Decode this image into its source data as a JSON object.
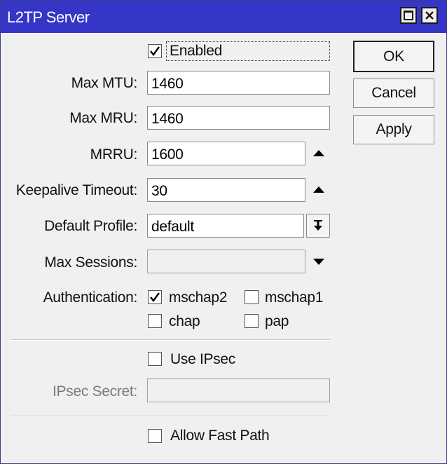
{
  "window": {
    "title": "L2TP Server"
  },
  "enabled": {
    "label": "Enabled",
    "checked": true
  },
  "fields": {
    "max_mtu": {
      "label": "Max MTU:",
      "value": "1460"
    },
    "max_mru": {
      "label": "Max MRU:",
      "value": "1460"
    },
    "mrru": {
      "label": "MRRU:",
      "value": "1600"
    },
    "keepalive_timeout": {
      "label": "Keepalive Timeout:",
      "value": "30"
    },
    "default_profile": {
      "label": "Default Profile:",
      "value": "default"
    },
    "max_sessions": {
      "label": "Max Sessions:",
      "value": ""
    }
  },
  "authentication": {
    "label": "Authentication:",
    "options": [
      {
        "label": "mschap2",
        "checked": true
      },
      {
        "label": "mschap1",
        "checked": false
      },
      {
        "label": "chap",
        "checked": false
      },
      {
        "label": "pap",
        "checked": false
      }
    ]
  },
  "use_ipsec": {
    "label": "Use IPsec",
    "checked": false
  },
  "ipsec_secret": {
    "label": "IPsec Secret:",
    "value": ""
  },
  "allow_fast_path": {
    "label": "Allow Fast Path",
    "checked": false
  },
  "buttons": {
    "ok": "OK",
    "cancel": "Cancel",
    "apply": "Apply"
  },
  "colors": {
    "titlebar": "#3535c8",
    "background": "#f0f0f0"
  }
}
